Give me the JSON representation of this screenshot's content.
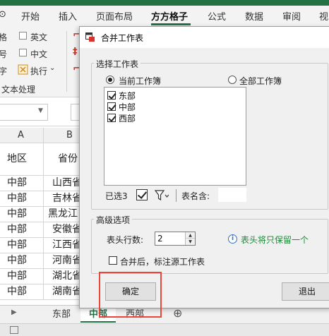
{
  "ribbon": {
    "tabs": [
      "开始",
      "插入",
      "页面布局",
      "方方格子",
      "公式",
      "数据",
      "审阅",
      "视"
    ],
    "active_tab": "方方格子",
    "partial_labels": [
      "格",
      "号",
      "字"
    ],
    "options": {
      "english": "英文",
      "chinese": "中文",
      "execute": "执行"
    },
    "group_label": "文本处理"
  },
  "sheet": {
    "columns": [
      "A",
      "B"
    ],
    "header_row": [
      "地区",
      "省份"
    ],
    "rows": [
      [
        "中部",
        "山西省"
      ],
      [
        "中部",
        "吉林省"
      ],
      [
        "中部",
        "黑龙江"
      ],
      [
        "中部",
        "安徽省"
      ],
      [
        "中部",
        "江西省"
      ],
      [
        "中部",
        "河南省"
      ],
      [
        "中部",
        "湖北省"
      ],
      [
        "中部",
        "湖南省"
      ]
    ],
    "tabs": [
      "东部",
      "中部",
      "西部"
    ],
    "active_tab": "中部",
    "add_sheet": "⊕"
  },
  "dialog": {
    "title": "合并工作表",
    "select_group_label": "选择工作表",
    "radio_current": "当前工作簿",
    "radio_all": "全部工作簿",
    "sheets": [
      {
        "name": "东部",
        "checked": true
      },
      {
        "name": "中部",
        "checked": true
      },
      {
        "name": "西部",
        "checked": true
      }
    ],
    "selected_label": "已选3",
    "sheetname_label": "表名含:",
    "sheetname_value": "",
    "advanced_label": "高级选项",
    "header_rows_label": "表头行数:",
    "header_rows_value": "2",
    "info_text": "表头将只保留一个",
    "mark_source_label": "合并后，标注源工作表",
    "ok": "确定",
    "cancel": "退出"
  },
  "colors": {
    "excel_green": "#217346",
    "highlight_red": "#e8473a",
    "info_green": "#1e8a3a"
  }
}
